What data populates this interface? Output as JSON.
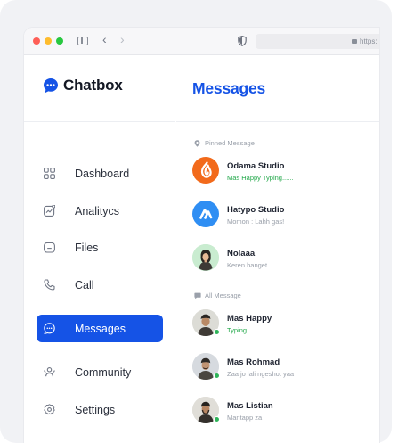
{
  "colors": {
    "accent": "#1553e6",
    "odama": "#f26a1b",
    "hatypo": "#2f8ef3",
    "online": "#2fb45a",
    "typing": "#22a84a"
  },
  "browser": {
    "url": "https:"
  },
  "app": {
    "name": "Chatbox",
    "logo_icon": "chat-bubble-icon"
  },
  "sidebar": {
    "items": [
      {
        "label": "Dashboard",
        "icon": "grid-icon"
      },
      {
        "label": "Analitycs",
        "icon": "analytics-icon"
      },
      {
        "label": "Files",
        "icon": "folder-icon"
      },
      {
        "label": "Call",
        "icon": "phone-icon"
      },
      {
        "label": "Messages",
        "icon": "message-icon",
        "active": true
      },
      {
        "label": "Community",
        "icon": "people-icon"
      },
      {
        "label": "Settings",
        "icon": "gear-icon"
      }
    ]
  },
  "main": {
    "title": "Messages",
    "pinned_label": "Pinned Message",
    "all_label": "All Message",
    "pinned": [
      {
        "name": "Odama Studio",
        "preview": "Mas Happy Typing......",
        "typing": true,
        "avatar": "odama-logo"
      },
      {
        "name": "Hatypo Studio",
        "preview": "Momon : Lahh gas!",
        "avatar": "hatypo-logo"
      },
      {
        "name": "Nolaaa",
        "preview": "Keren banget",
        "avatar": "person-photo"
      }
    ],
    "all": [
      {
        "name": "Mas Happy",
        "preview": "Typing...",
        "typing": true,
        "online": true
      },
      {
        "name": "Mas Rohmad",
        "preview": "Zaa jo lali ngeshot yaa",
        "online": true
      },
      {
        "name": "Mas Listian",
        "preview": "Mantapp za",
        "online": true
      }
    ]
  }
}
